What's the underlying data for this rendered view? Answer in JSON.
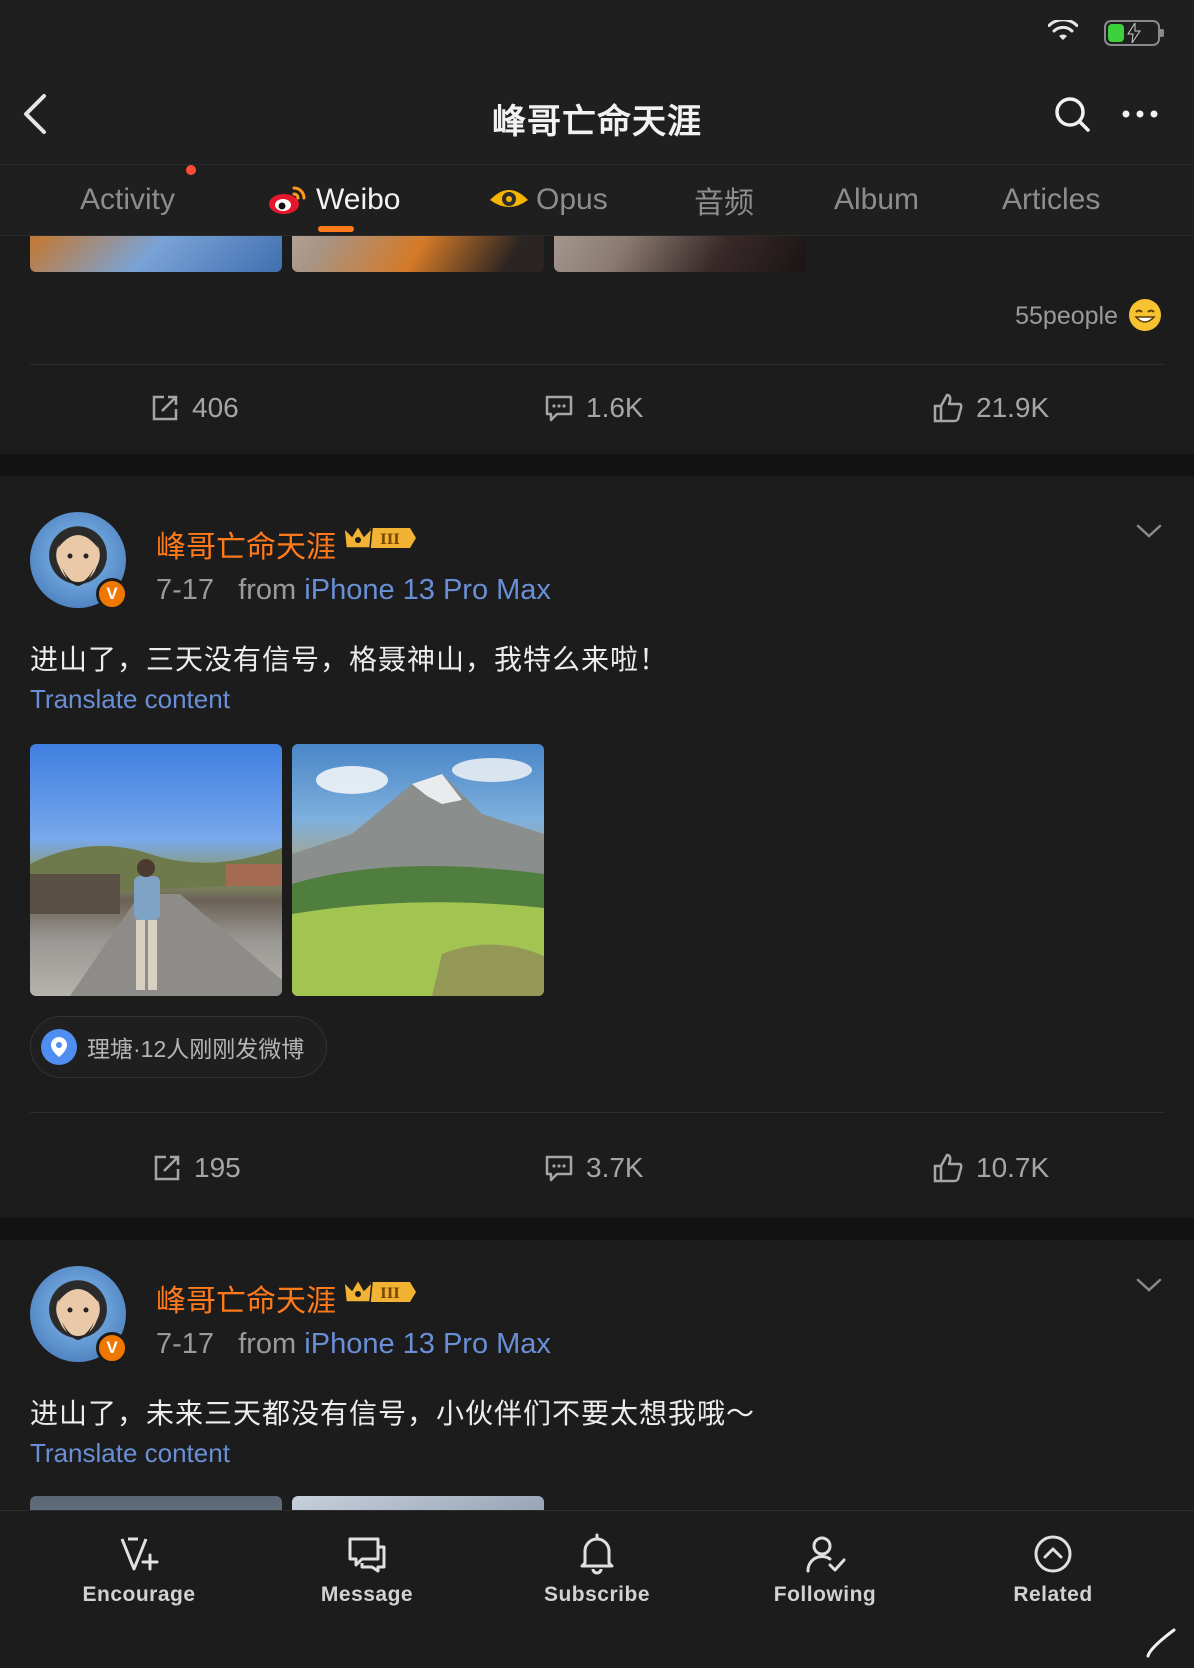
{
  "header": {
    "title": "峰哥亡命天涯"
  },
  "tabs": [
    {
      "label": "Activity",
      "active": false,
      "has_dot": true
    },
    {
      "label": "Weibo",
      "active": true,
      "icon": "weibo-logo-icon"
    },
    {
      "label": "Opus",
      "active": false,
      "icon": "opus-eye-icon"
    },
    {
      "label": "音频",
      "active": false
    },
    {
      "label": "Album",
      "active": false
    },
    {
      "label": "Articles",
      "active": false
    }
  ],
  "post0": {
    "people": "55people",
    "repost": "406",
    "comment": "1.6K",
    "like": "21.9K"
  },
  "post1": {
    "author": "峰哥亡命天涯",
    "date": "7-17",
    "from_label": "from",
    "source": "iPhone 13 Pro Max",
    "text": "进山了，三天没有信号，格聂神山，我特么来啦！",
    "translate": "Translate content",
    "location": "理塘·12人刚刚发微博",
    "repost": "195",
    "comment": "3.7K",
    "like": "10.7K"
  },
  "post2": {
    "author": "峰哥亡命天涯",
    "date": "7-17",
    "from_label": "from",
    "source": "iPhone 13 Pro Max",
    "text": "进山了，未来三天都没有信号，小伙伴们不要太想我哦～",
    "translate": "Translate content"
  },
  "bottom_bar": [
    {
      "label": "Encourage",
      "icon": "encourage-icon"
    },
    {
      "label": "Message",
      "icon": "message-icon"
    },
    {
      "label": "Subscribe",
      "icon": "bell-icon"
    },
    {
      "label": "Following",
      "icon": "person-check-icon"
    },
    {
      "label": "Related",
      "icon": "related-up-icon"
    }
  ],
  "vip_badge_text": "III",
  "verified_badge": "V",
  "colors": {
    "accent": "#ff7a1a",
    "link": "#6a8fd6",
    "background": "#1c1c1c",
    "separator": "#121212"
  }
}
